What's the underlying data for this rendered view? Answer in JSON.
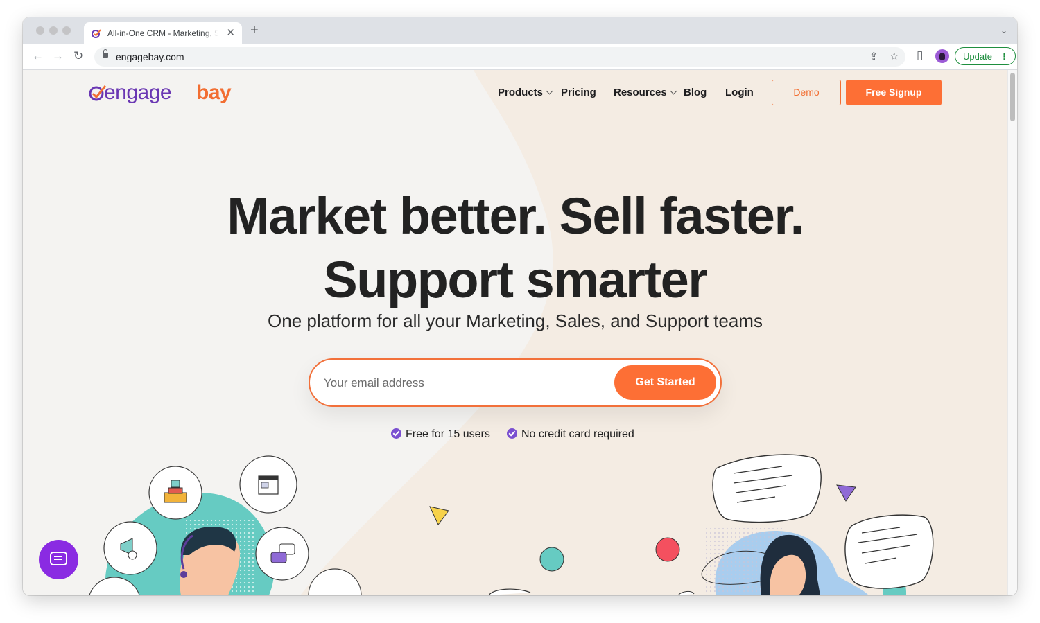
{
  "browser": {
    "tab_title": "All-in-One CRM - Marketing, Sales",
    "tab_close": "✕",
    "new_tab": "+",
    "tab_menu": "⌄",
    "url": "engagebay.com",
    "update_label": "Update",
    "update_menu": "⋮",
    "back_icon": "←",
    "forward_icon": "→",
    "reload_icon": "↻",
    "share_icon": "⇪",
    "star_icon": "☆",
    "sidepanel_icon": "▯"
  },
  "site": {
    "logo_text_a": "engage",
    "logo_text_b": "bay",
    "nav": {
      "products": "Products",
      "pricing": "Pricing",
      "resources": "Resources",
      "blog": "Blog",
      "login": "Login"
    },
    "demo_button": "Demo",
    "signup_button": "Free Signup"
  },
  "hero": {
    "headline_line1": "Market better. Sell faster.",
    "headline_line2": "Support smarter",
    "subheadline": "One platform for all your Marketing, Sales, and Support teams",
    "email_placeholder": "Your email address",
    "cta_button": "Get Started",
    "benefit_1": "Free for 15 users",
    "benefit_2": "No credit card required"
  },
  "colors": {
    "brand_purple": "#6a37b3",
    "brand_orange": "#fd6f35",
    "chat_widget": "#8a2be2"
  }
}
